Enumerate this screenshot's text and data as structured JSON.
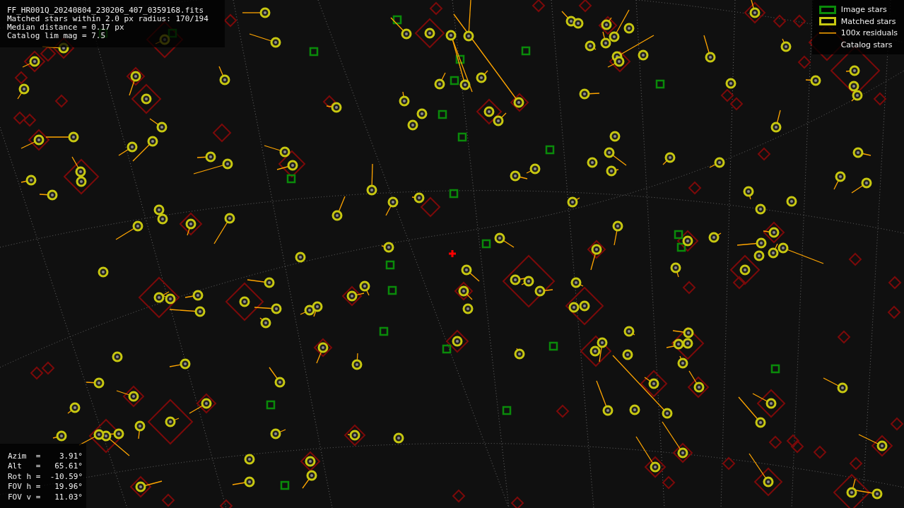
{
  "info_lines": [
    "FF_HR001Q_20240804_230206_407_0359168.fits",
    "Matched stars within 2.0 px radius: 170/194",
    "Median distance = 0.17 px",
    "Catalog lim mag = 7.5"
  ],
  "legend": [
    {
      "kind": "image",
      "label": "Image stars"
    },
    {
      "kind": "matched",
      "label": "Matched stars"
    },
    {
      "kind": "residual",
      "label": "100x residuals"
    },
    {
      "kind": "catalog",
      "label": "Catalog stars"
    }
  ],
  "pointing": [
    {
      "label": "Azim  =",
      "value": "3.91°"
    },
    {
      "label": "Alt   =",
      "value": "65.61°"
    },
    {
      "label": "Rot h =",
      "value": "-10.59°"
    },
    {
      "label": "FOV h =",
      "value": "19.96°"
    },
    {
      "label": "FOV v =",
      "value": "11.03°"
    }
  ]
}
